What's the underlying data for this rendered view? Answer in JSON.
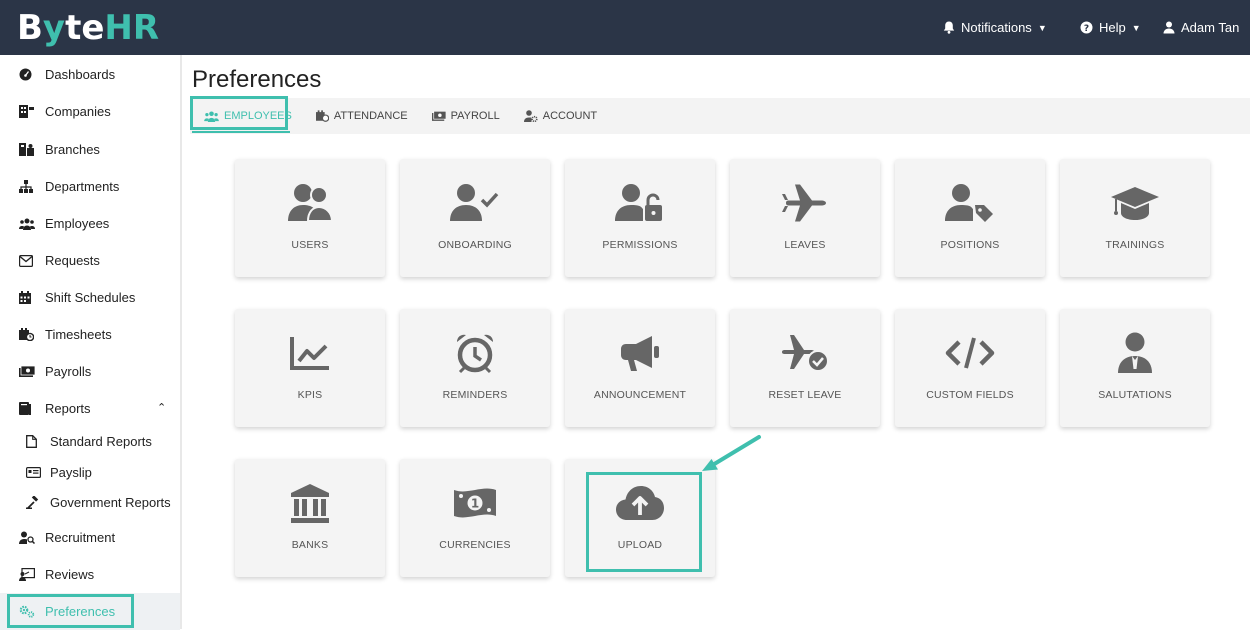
{
  "app": {
    "logo_main": "B",
    "logo_mid": "te",
    "logo_hr": "HR",
    "logo_glyph": "y"
  },
  "topbar": {
    "notifications": "Notifications",
    "help": "Help",
    "user": "Adam Tan"
  },
  "sidebar": {
    "items": [
      {
        "label": "Dashboards",
        "icon": "dashboard-icon"
      },
      {
        "label": "Companies",
        "icon": "building-icon"
      },
      {
        "label": "Branches",
        "icon": "branches-icon"
      },
      {
        "label": "Departments",
        "icon": "sitemap-icon"
      },
      {
        "label": "Employees",
        "icon": "users-icon"
      },
      {
        "label": "Requests",
        "icon": "envelope-icon"
      },
      {
        "label": "Shift Schedules",
        "icon": "calendar-icon"
      },
      {
        "label": "Timesheets",
        "icon": "calendar-clock-icon"
      },
      {
        "label": "Payrolls",
        "icon": "money-icon"
      },
      {
        "label": "Reports",
        "icon": "book-icon"
      },
      {
        "label": "Standard Reports",
        "icon": "file-icon"
      },
      {
        "label": "Payslip",
        "icon": "id-card-icon"
      },
      {
        "label": "Government Reports",
        "icon": "gavel-icon"
      },
      {
        "label": "Recruitment",
        "icon": "user-search-icon"
      },
      {
        "label": "Reviews",
        "icon": "chalkboard-icon"
      },
      {
        "label": "Preferences",
        "icon": "cogs-icon"
      }
    ]
  },
  "page": {
    "title": "Preferences",
    "tabs": [
      {
        "label": "EMPLOYEES"
      },
      {
        "label": "ATTENDANCE"
      },
      {
        "label": "PAYROLL"
      },
      {
        "label": "ACCOUNT"
      }
    ]
  },
  "cards": [
    {
      "label": "USERS",
      "icon": "users-icon"
    },
    {
      "label": "ONBOARDING",
      "icon": "user-check-icon"
    },
    {
      "label": "PERMISSIONS",
      "icon": "user-lock-icon"
    },
    {
      "label": "LEAVES",
      "icon": "plane-icon"
    },
    {
      "label": "POSITIONS",
      "icon": "user-tag-icon"
    },
    {
      "label": "TRAININGS",
      "icon": "graduation-cap-icon"
    },
    {
      "label": "KPIS",
      "icon": "chart-line-icon"
    },
    {
      "label": "REMINDERS",
      "icon": "alarm-clock-icon"
    },
    {
      "label": "ANNOUNCEMENT",
      "icon": "bullhorn-icon"
    },
    {
      "label": "RESET LEAVE",
      "icon": "plane-check-icon"
    },
    {
      "label": "CUSTOM FIELDS",
      "icon": "code-icon"
    },
    {
      "label": "SALUTATIONS",
      "icon": "user-tie-icon"
    },
    {
      "label": "BANKS",
      "icon": "bank-icon"
    },
    {
      "label": "CURRENCIES",
      "icon": "money-bill-icon"
    },
    {
      "label": "UPLOAD",
      "icon": "cloud-upload-icon"
    }
  ],
  "colors": {
    "accent": "#3fbfae",
    "topbar": "#2b3547",
    "icon": "#666666"
  }
}
